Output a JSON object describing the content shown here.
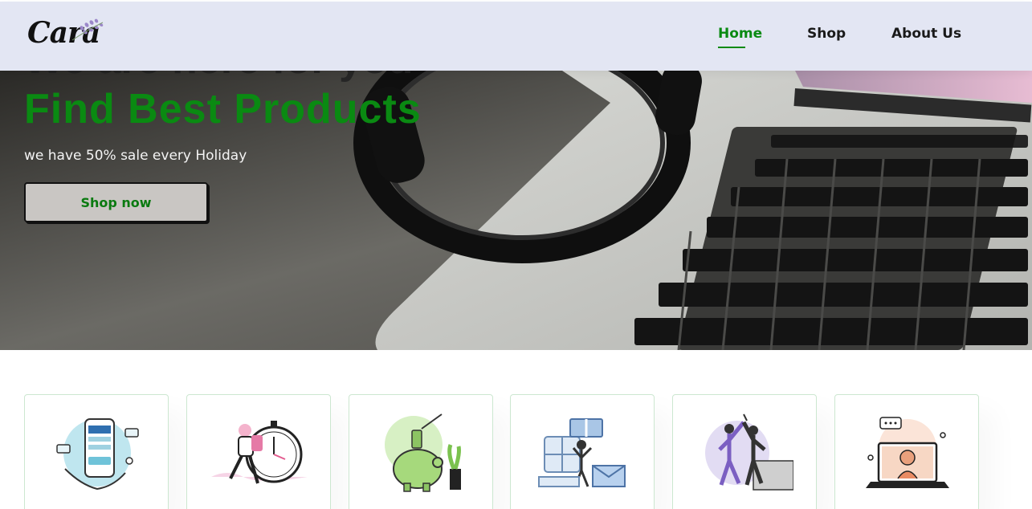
{
  "brand": {
    "name": "Cara"
  },
  "nav": {
    "items": [
      {
        "label": "Home",
        "active": true
      },
      {
        "label": "Shop",
        "active": false
      },
      {
        "label": "About Us",
        "active": false
      }
    ]
  },
  "hero": {
    "overline": "We are here for you",
    "title": "Find Best Products",
    "subtitle": "we have 50% sale every Holiday",
    "button_label": "Shop now"
  },
  "features": {
    "items": [
      {
        "icon": "payment-phone-illustration"
      },
      {
        "icon": "fast-delivery-clock-illustration"
      },
      {
        "icon": "piggy-bank-saving-illustration"
      },
      {
        "icon": "gift-mail-celebration-illustration"
      },
      {
        "icon": "high-five-team-illustration"
      },
      {
        "icon": "customer-support-laptop-illustration"
      }
    ]
  },
  "colors": {
    "accent": "#0a8a12",
    "header_bg": "#e3e6f3",
    "feature_border": "#cce7d0",
    "button_bg": "#c9c6c3"
  }
}
